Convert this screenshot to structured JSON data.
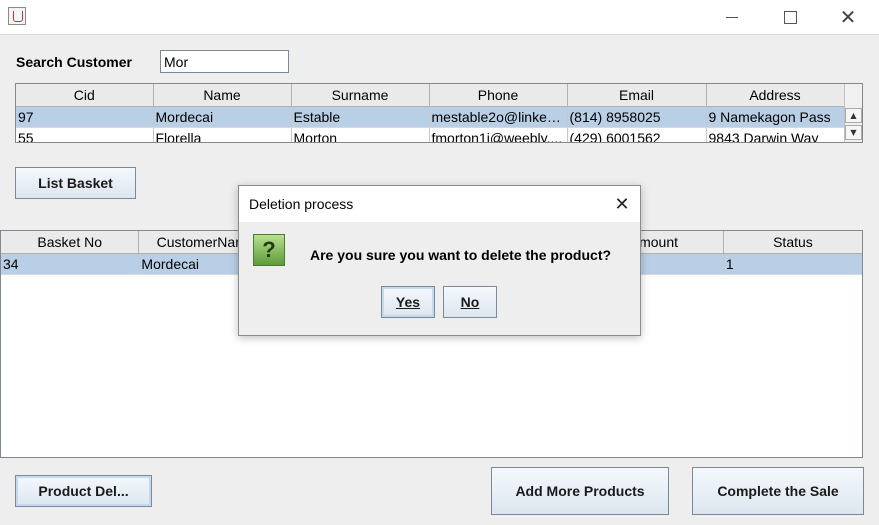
{
  "window": {
    "title": ""
  },
  "search": {
    "label": "Search Customer",
    "value": "Mor"
  },
  "customers": {
    "headers": [
      "Cid",
      "Name",
      "Surname",
      "Phone",
      "Email",
      "Address"
    ],
    "rows": [
      [
        "97",
        "Mordecai",
        "Estable",
        "mestable2o@linked...",
        "(814) 8958025",
        "9 Namekagon Pass"
      ],
      [
        "55",
        "Florella",
        "Morton",
        "fmorton1i@weebly....",
        "(429) 6001562",
        "9843 Darwin Way"
      ]
    ],
    "selected_row": 0
  },
  "buttons": {
    "list_basket": "List Basket",
    "product_del": "Product Del...",
    "add_more": "Add More Products",
    "complete_sale": "Complete the Sale"
  },
  "basket": {
    "headers": [
      "Basket No",
      "CustomerName",
      "",
      "",
      "Amount",
      "Status"
    ],
    "rows": [
      [
        "34",
        "Mordecai",
        "",
        "",
        "",
        "1"
      ]
    ]
  },
  "dialog": {
    "title": "Deletion process",
    "message": "Are you sure you want to delete the product?",
    "icon": "question-icon",
    "yes_label": "Yes",
    "no_label": "No"
  },
  "colors": {
    "selection": "#b8cfe5",
    "background": "#eeeeee",
    "icon_green": "#5f9a3a"
  }
}
